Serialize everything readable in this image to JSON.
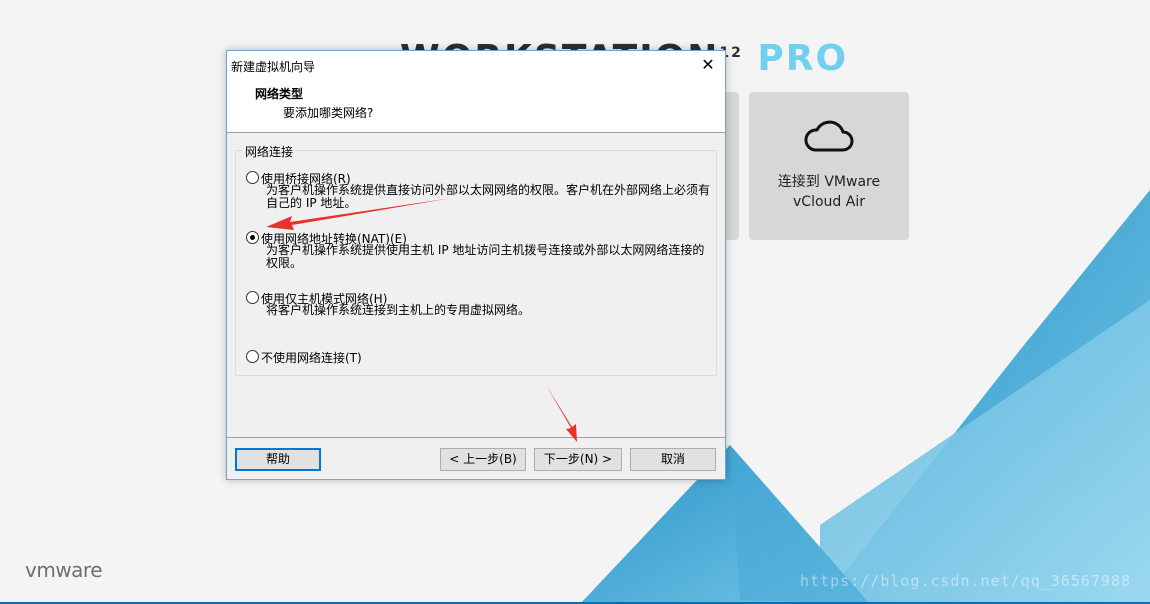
{
  "background": {
    "brand_text": "WORKSTATION",
    "brand_version": "12",
    "brand_edition": "PRO",
    "tile_cloud_label": "连接到 VMware vCloud Air",
    "logo": "vmware",
    "watermark": "https://blog.csdn.net/qq_36567988"
  },
  "dialog": {
    "title": "新建虚拟机向导",
    "close_label": "✕",
    "header_title": "网络类型",
    "header_subtitle": "要添加哪类网络?",
    "group_label": "网络连接",
    "options": [
      {
        "label": "使用桥接网络(R)",
        "desc": "为客户机操作系统提供直接访问外部以太网网络的权限。客户机在外部网络上必须有自己的 IP 地址。",
        "checked": false
      },
      {
        "label": "使用网络地址转换(NAT)(E)",
        "desc": "为客户机操作系统提供使用主机 IP 地址访问主机拨号连接或外部以太网网络连接的权限。",
        "checked": true
      },
      {
        "label": "使用仅主机模式网络(H)",
        "desc": "将客户机操作系统连接到主机上的专用虚拟网络。",
        "checked": false
      },
      {
        "label": "不使用网络连接(T)",
        "desc": "",
        "checked": false
      }
    ],
    "buttons": {
      "help": "帮助",
      "back": "< 上一步(B)",
      "next": "下一步(N) >",
      "cancel": "取消"
    }
  },
  "colors": {
    "accent_blue": "#0078d7",
    "annotation_red": "#e8322e"
  }
}
